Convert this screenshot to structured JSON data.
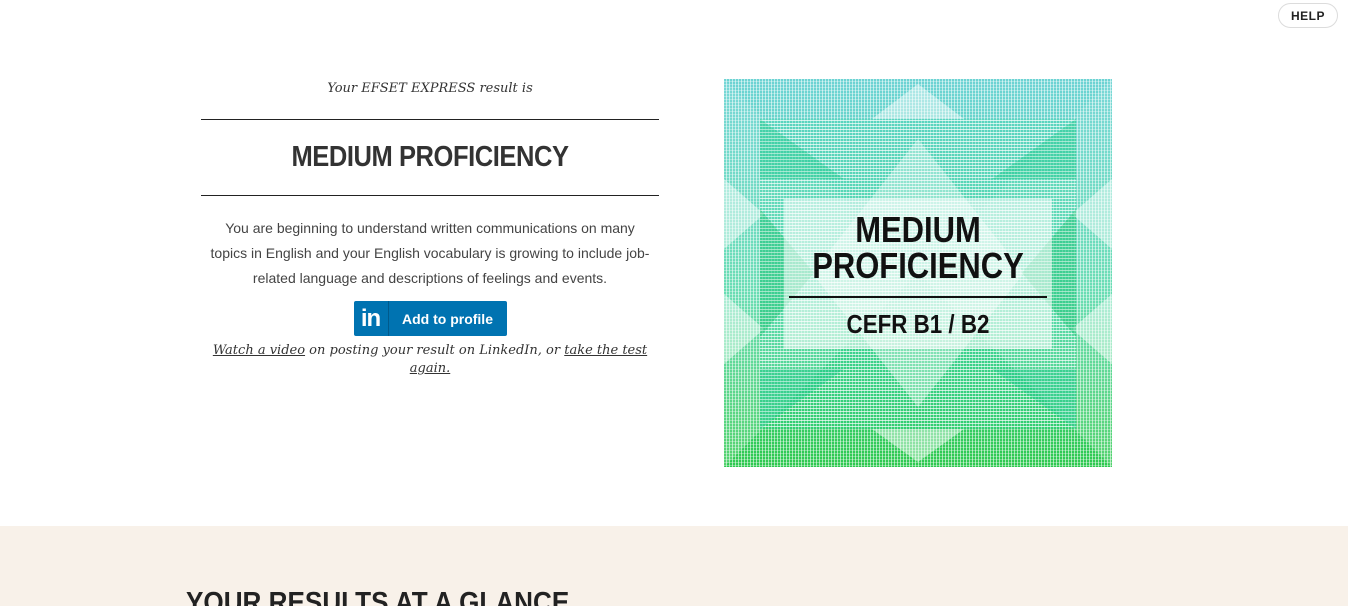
{
  "header": {
    "help_label": "HELP"
  },
  "result": {
    "intro": "Your EFSET EXPRESS result is",
    "level": "MEDIUM PROFICIENCY",
    "description": "You are beginning to understand written communications on many topics in English and your English vocabulary is growing to include job-related language and descriptions of feelings and events.",
    "linkedin_logo": "in",
    "linkedin_label": "Add to profile",
    "followup": {
      "watch_link": "Watch a video",
      "middle_text": " on posting your result on LinkedIn, or ",
      "retake_link": "take the test again."
    }
  },
  "badge": {
    "level": "MEDIUM\nPROFICIENCY",
    "cefr": "CEFR B1 / B2",
    "colors": {
      "top": "#5ccfcf",
      "middle": "#4ad6a4",
      "bottom": "#2ec94f",
      "text": "#111111"
    }
  },
  "glance": {
    "title": "YOUR RESULTS AT A GLANCE"
  },
  "colors": {
    "linkedin": "#0073b1",
    "section_bg": "#f8f1e9"
  }
}
